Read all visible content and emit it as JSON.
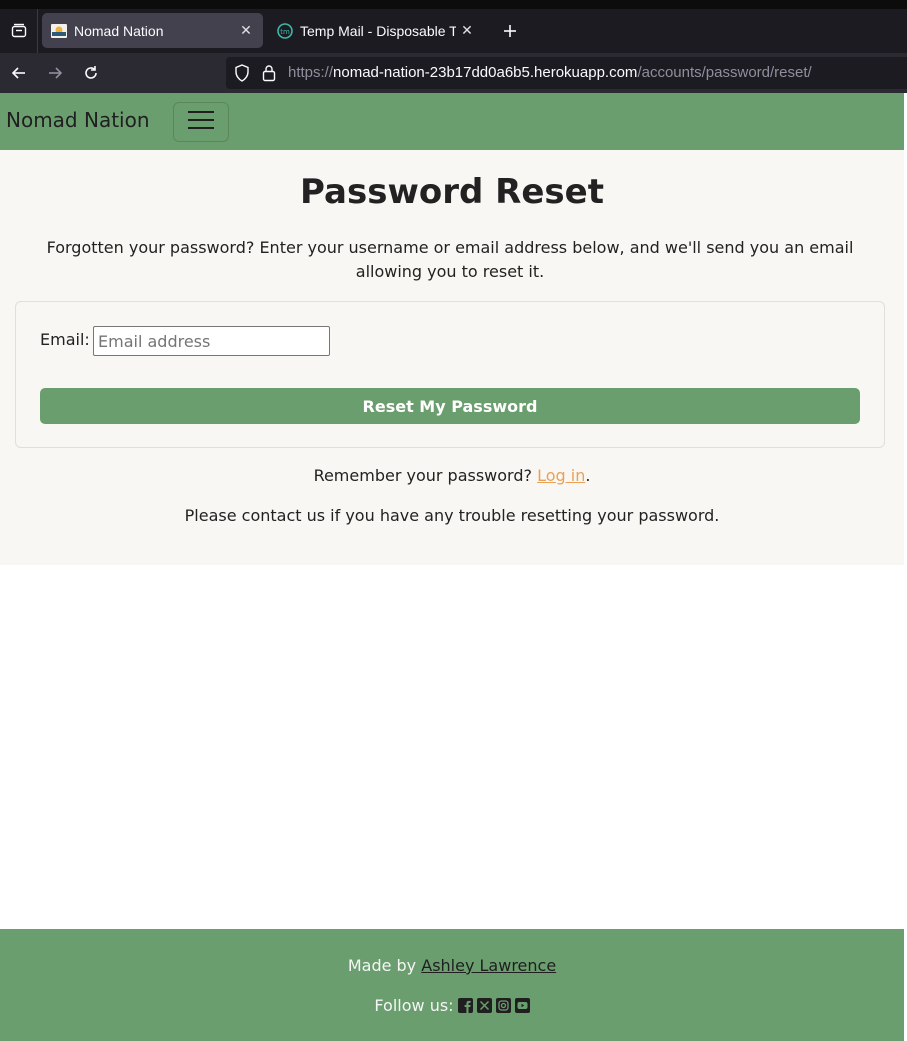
{
  "browser": {
    "tabs": [
      {
        "title": "Nomad Nation",
        "active": true
      },
      {
        "title": "Temp Mail - Disposable Te",
        "active": false
      }
    ],
    "url": {
      "scheme": "https://",
      "host": "nomad-nation-23b17dd0a6b5.herokuapp.com",
      "path": "/accounts/password/reset/"
    },
    "icons": {
      "tab_list": "tab-list-icon",
      "close": "close-icon",
      "new_tab": "plus-icon",
      "back": "back-arrow-icon",
      "forward": "forward-arrow-icon",
      "reload": "reload-icon",
      "shield": "shield-icon",
      "lock": "lock-icon"
    }
  },
  "site": {
    "brand": "Nomad Nation",
    "menu_icon": "hamburger-icon",
    "colors": {
      "primary": "#6b9e6e",
      "link": "#e9a157",
      "background": "#f9f7f4"
    }
  },
  "main": {
    "title": "Password Reset",
    "intro": "Forgotten your password? Enter your username or email address below, and we'll send you an email allowing you to reset it.",
    "form": {
      "email_label": "Email:",
      "email_placeholder": "Email address",
      "email_value": "",
      "submit_label": "Reset My Password"
    },
    "remember_text": "Remember your password?",
    "login_link": "Log in",
    "remember_suffix": ".",
    "contact_text": "Please contact us if you have any trouble resetting your password."
  },
  "footer": {
    "made_by_prefix": "Made by",
    "author": "Ashley Lawrence",
    "follow_label": "Follow us:",
    "socials": [
      "facebook-icon",
      "x-icon",
      "instagram-icon",
      "youtube-icon"
    ]
  }
}
